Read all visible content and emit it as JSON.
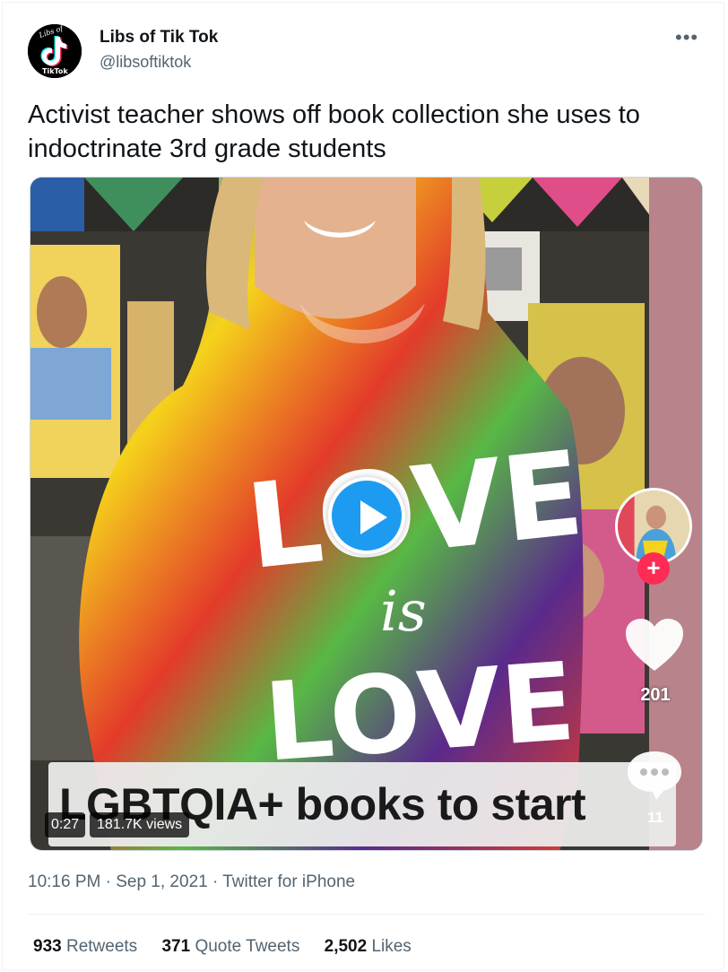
{
  "author": {
    "name": "Libs of Tik Tok",
    "handle": "@libsoftiktok",
    "avatar_top_text": "Libs of",
    "avatar_bottom_text": "TikTok"
  },
  "tweet": {
    "text": "Activist teacher shows off book collection she uses to indoctrinate 3rd grade students"
  },
  "media": {
    "caption": "LGBTQIA+ books to start",
    "duration": "0:27",
    "views": "181.7K views",
    "tiktok_likes": "201",
    "tiktok_comments": "11",
    "shirt_words": {
      "top": "LOVE",
      "middle": "is",
      "bottom": "LOVE"
    }
  },
  "meta": {
    "time": "10:16 PM",
    "separator": "·",
    "date": "Sep 1, 2021",
    "source": "Twitter for iPhone"
  },
  "stats": {
    "retweets": {
      "count": "933",
      "label": "Retweets"
    },
    "quotes": {
      "count": "371",
      "label": "Quote Tweets"
    },
    "likes": {
      "count": "2,502",
      "label": "Likes"
    }
  },
  "icons": {
    "more": "more-horizontal-icon",
    "play": "play-icon",
    "heart": "heart-icon",
    "comment": "comment-bubble-icon",
    "follow": "plus-icon"
  },
  "colors": {
    "accent": "#1d9bf0",
    "secondary_text": "#536471",
    "tiktok_red": "#fe2c55"
  }
}
